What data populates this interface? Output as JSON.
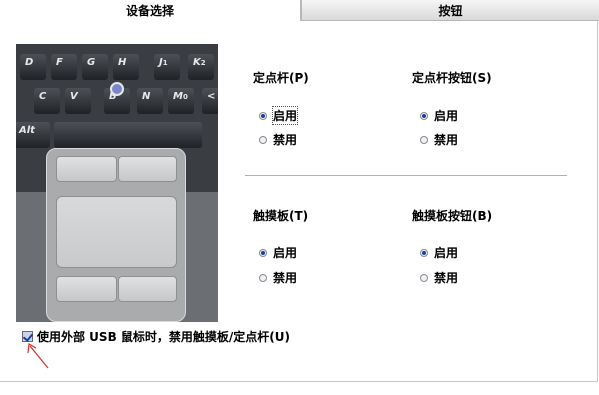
{
  "tabs": [
    {
      "label": "设备选择",
      "active": true
    },
    {
      "label": "按钮",
      "active": false
    }
  ],
  "keyboard": {
    "row1": [
      {
        "main": "D",
        "sub": ""
      },
      {
        "main": "F",
        "sub": ""
      },
      {
        "main": "G",
        "sub": ""
      },
      {
        "main": "H",
        "sub": ""
      },
      {
        "main": "J",
        "sub": "1"
      },
      {
        "main": "K",
        "sub": "2"
      }
    ],
    "row2": [
      {
        "main": "C",
        "sub": ""
      },
      {
        "main": "V",
        "sub": ""
      },
      {
        "main": "B",
        "sub": ""
      },
      {
        "main": "N",
        "sub": ""
      },
      {
        "main": "M",
        "sub": "0"
      },
      {
        "main": "<",
        "sub": ""
      }
    ],
    "alt_label": "Alt"
  },
  "pointing_stick": {
    "title": "定点杆(P)",
    "options": [
      "启用",
      "禁用"
    ],
    "selected": 0
  },
  "pointing_stick_buttons": {
    "title": "定点杆按钮(S)",
    "options": [
      "启用",
      "禁用"
    ],
    "selected": 0
  },
  "touchpad": {
    "title": "触摸板(T)",
    "options": [
      "启用",
      "禁用"
    ],
    "selected": 0
  },
  "touchpad_buttons": {
    "title": "触摸板按钮(B)",
    "options": [
      "启用",
      "禁用"
    ],
    "selected": 0
  },
  "usb_option": {
    "label": "使用外部 USB 鼠标时，禁用触摸板/定点杆(U)",
    "checked": true
  },
  "colors": {
    "radio_selected": "#1a3fa0",
    "annotation_arrow": "#d9302a"
  }
}
